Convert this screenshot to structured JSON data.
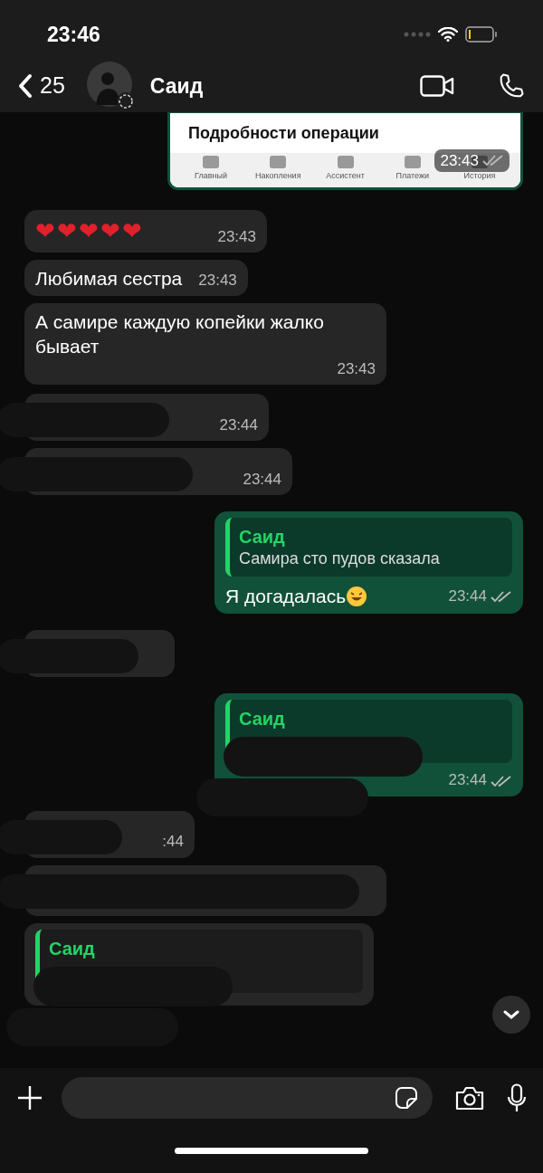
{
  "status_bar": {
    "time": "23:46"
  },
  "header": {
    "back_count": "25",
    "contact": "Саид"
  },
  "messages": [
    {
      "kind": "image",
      "outgoing": true,
      "time": "23:43",
      "screenshot": {
        "title": "Подробности операции",
        "tabs": [
          "Главный",
          "Накопления",
          "Ассистент",
          "Платежи",
          "История"
        ]
      }
    },
    {
      "kind": "text",
      "outgoing": false,
      "text": "❤❤❤❤❤",
      "time": "23:43"
    },
    {
      "kind": "text",
      "outgoing": false,
      "text": "Любимая сестра",
      "time": "23:43"
    },
    {
      "kind": "text",
      "outgoing": false,
      "text": "А самире каждую копейки жалко бывает",
      "time": "23:43"
    },
    {
      "kind": "redacted",
      "outgoing": false,
      "time": "23:44"
    },
    {
      "kind": "redacted",
      "outgoing": false,
      "time": "23:44"
    },
    {
      "kind": "reply",
      "outgoing": true,
      "quote_author": "Саид",
      "quote_text": "Самира сто пудов сказала",
      "text": "Я догадалась",
      "emoji": true,
      "time": "23:44"
    },
    {
      "kind": "redacted",
      "outgoing": false
    },
    {
      "kind": "reply",
      "outgoing": true,
      "quote_author": "Саид",
      "time": "23:44"
    },
    {
      "kind": "redacted",
      "outgoing": false,
      "time": ":44"
    },
    {
      "kind": "redacted",
      "outgoing": false
    },
    {
      "kind": "reply",
      "outgoing": false,
      "quote_author": "Саид"
    }
  ]
}
